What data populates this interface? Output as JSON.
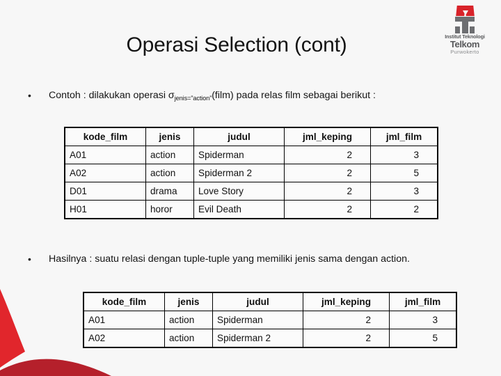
{
  "slide": {
    "title": "Operasi Selection (cont)",
    "background_color": "#f7f7f7",
    "accent_red": "#e1262c",
    "accent_red_dark": "#b5202b"
  },
  "logo": {
    "line1": "Institut Teknologi",
    "line2": "Telkom",
    "line3": "Purwokerto",
    "mark_color": "#d8232a",
    "text_color": "#58595b"
  },
  "bullets": [
    {
      "marker": "•",
      "text_before": "Contoh : dilakukan operasi σ",
      "subscript": "jenis=”action”",
      "text_after": "(film) pada relas film sebagai berikut :"
    },
    {
      "marker": "•",
      "text": "Hasilnya : suatu relasi dengan tuple-tuple yang memiliki jenis sama dengan action."
    }
  ],
  "table1": {
    "headers": [
      "kode_film",
      "jenis",
      "judul",
      "jml_keping",
      "jml_film"
    ],
    "rows": [
      [
        "A01",
        "action",
        "Spiderman",
        "2",
        "3"
      ],
      [
        "A02",
        "action",
        "Spiderman 2",
        "2",
        "5"
      ],
      [
        "D01",
        "drama",
        "Love Story",
        "2",
        "3"
      ],
      [
        "H01",
        "horor",
        "Evil Death",
        "2",
        "2"
      ]
    ]
  },
  "table2": {
    "headers": [
      "kode_film",
      "jenis",
      "judul",
      "jml_keping",
      "jml_film"
    ],
    "rows": [
      [
        "A01",
        "action",
        "Spiderman",
        "2",
        "3"
      ],
      [
        "A02",
        "action",
        "Spiderman 2",
        "2",
        "5"
      ]
    ]
  }
}
